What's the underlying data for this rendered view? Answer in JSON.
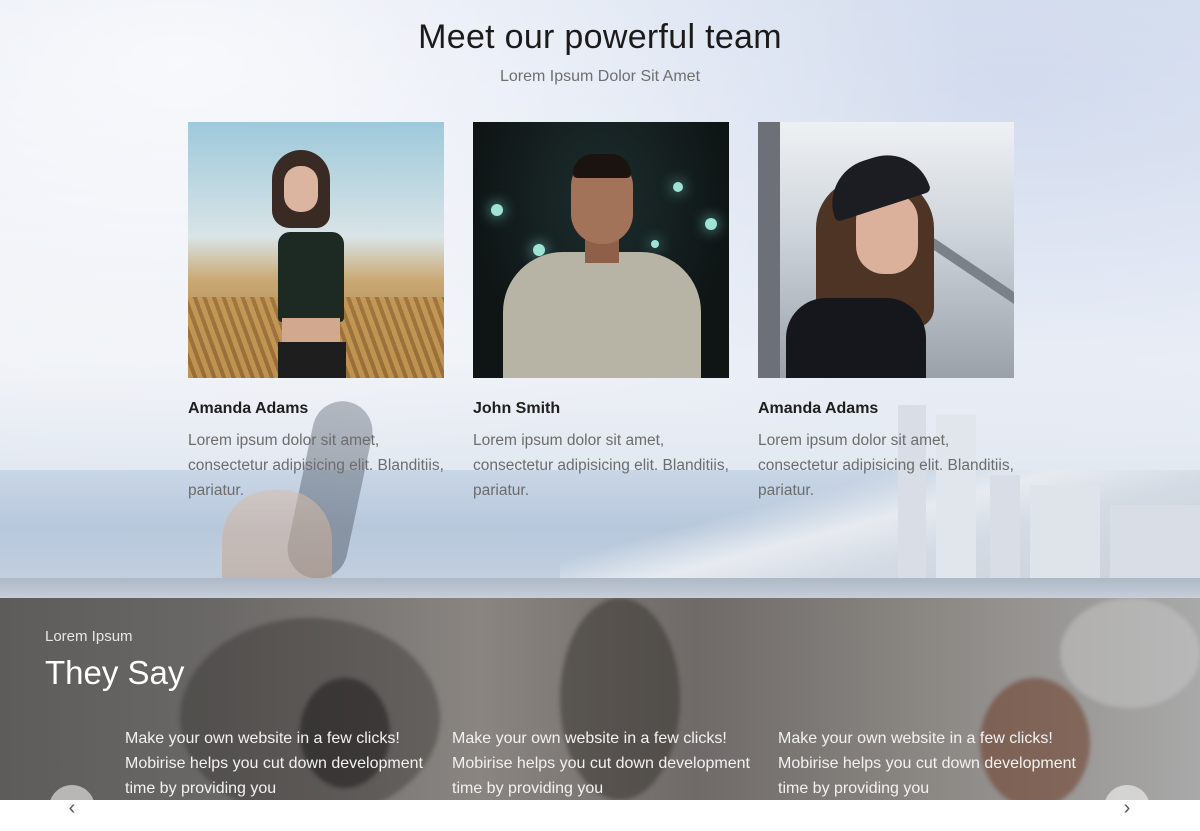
{
  "team": {
    "title": "Meet our powerful team",
    "subtitle": "Lorem Ipsum Dolor Sit Amet",
    "members": [
      {
        "name": "Amanda Adams",
        "description": "Lorem ipsum dolor sit amet, consectetur adipisicing elit. Blanditiis, pariatur.",
        "photo": "woman-in-wheat-field-photo"
      },
      {
        "name": "John Smith",
        "description": "Lorem ipsum dolor sit amet, consectetur adipisicing elit. Blanditiis, pariatur.",
        "photo": "man-at-night-photo"
      },
      {
        "name": "Amanda Adams",
        "description": "Lorem ipsum dolor sit amet, consectetur adipisicing elit. Blanditiis, pariatur.",
        "photo": "woman-with-cap-photo"
      }
    ]
  },
  "testimonials": {
    "eyebrow": "Lorem Ipsum",
    "title": "They Say",
    "quotes": [
      {
        "text": "Make your own website in a few clicks! Mobirise helps you cut down development time by providing you"
      },
      {
        "text": "Make your own website in a few clicks! Mobirise helps you cut down development time by providing you"
      },
      {
        "text": "Make your own website in a few clicks! Mobirise helps you cut down development time by providing you"
      }
    ],
    "prev_icon": "chevron-left-icon",
    "next_icon": "chevron-right-icon"
  },
  "colors": {
    "heading": "#1b1b1b",
    "body_text": "#6c6c6c",
    "testimonial_text": "#ffffff"
  }
}
